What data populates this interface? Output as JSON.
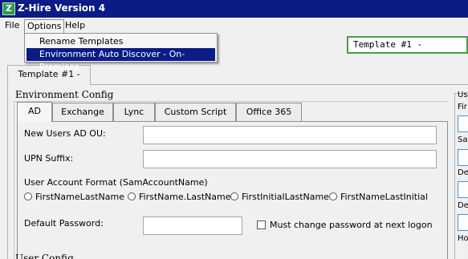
{
  "window": {
    "title": "Z-Hire Version 4",
    "icon_letter": "Z"
  },
  "menubar": {
    "file": "File",
    "options": "Options",
    "help": "Help"
  },
  "options_menu": {
    "rename_templates": "Rename Templates",
    "environment_auto_discover": "Environment Auto Discover - On-Premises"
  },
  "template_select": {
    "value": "Template #1 -"
  },
  "main_tab": {
    "label": "Template #1 -"
  },
  "environment_config": {
    "title": "Environment Config",
    "tabs": [
      "AD",
      "Exchange",
      "Lync",
      "Custom Script",
      "Office 365"
    ],
    "active_tab": "AD"
  },
  "ad": {
    "ou_label": "New Users AD OU:",
    "ou_value": "",
    "upn_label": "UPN Suffix:",
    "upn_value": "",
    "format_label": "User Account Format (SamAccountName)",
    "formats": [
      "FirstNameLastName",
      "FirstName.LastName",
      "FirstInitialLastName",
      "FirstNameLastInitial"
    ],
    "password_label": "Default Password:",
    "password_value": "",
    "must_change_label": "Must change password at next logon",
    "must_change_checked": false
  },
  "user_config": {
    "title": "User Config"
  },
  "right_panel": {
    "title_fragment": "Us",
    "labels": [
      "Fir",
      "Sa",
      "De",
      "De",
      "Ho"
    ]
  }
}
